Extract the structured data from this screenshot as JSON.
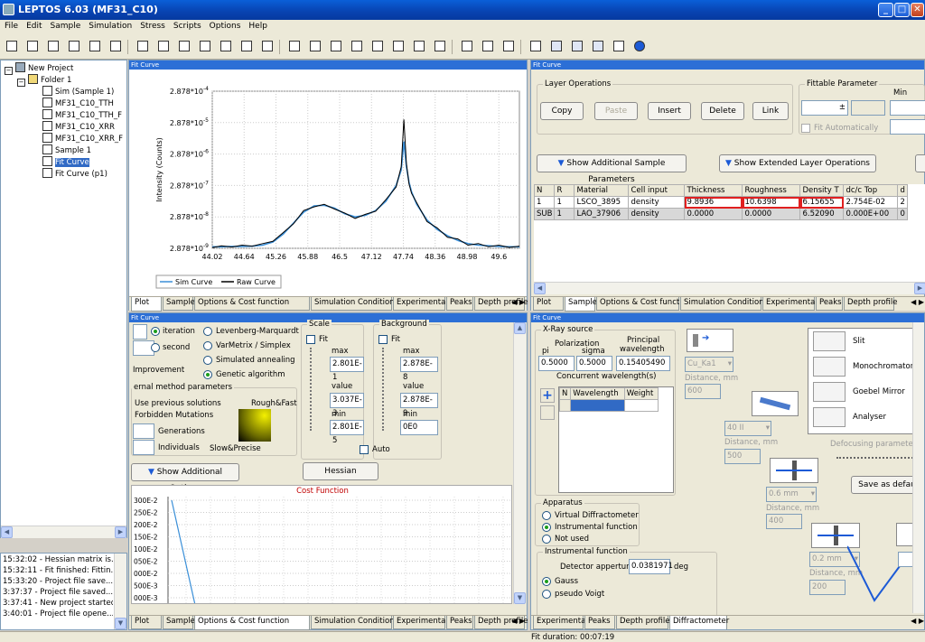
{
  "window": {
    "title": "LEPTOS 6.03 (MF31_C10)",
    "min": "_",
    "max": "□",
    "close": "✕"
  },
  "menu": [
    "File",
    "Edit",
    "Sample",
    "Simulation",
    "Stress",
    "Scripts",
    "Options",
    "Help"
  ],
  "tree": {
    "root": "New Project",
    "folder": "Folder 1",
    "items": [
      "Sim (Sample 1)",
      "MF31_C10_TTH",
      "MF31_C10_TTH_F",
      "MF31_C10_XRR",
      "MF31_C10_XRR_F",
      "Sample 1",
      "Fit Curve",
      "Fit Curve (p1)"
    ],
    "selected_index": 6
  },
  "log": [
    "15:32:02 - Hessian matrix is...",
    "15:32:11 - Fit finished: Fittin...",
    "15:33:20 - Project file save...",
    "3:37:37 - Project file saved...",
    "3:37:41 - New project started",
    "3:40:01 - Project file opene..."
  ],
  "panel_titles": {
    "top_left": "Fit Curve",
    "top_right": "Fit Curve",
    "bottom_left": "Fit Curve",
    "bottom_right": "Fit Curve"
  },
  "chart_data": {
    "type": "line",
    "title": "",
    "xlabel": "",
    "ylabel": "Intensity (Counts)",
    "log_y": true,
    "x_ticks": [
      "44.02",
      "44.64",
      "45.26",
      "45.88",
      "46.5",
      "47.12",
      "47.74",
      "48.36",
      "48.98",
      "49.6"
    ],
    "y_ticks": [
      "2.878*10^-4",
      "2.878*10^-5",
      "2.878*10^-6",
      "2.878*10^-7",
      "2.878*10^-8",
      "2.878*10^-9"
    ],
    "xlim": [
      44.02,
      50.0
    ],
    "ylim_exp": [
      -9,
      -4
    ],
    "legend": [
      "Sim Curve",
      "Raw Curve"
    ],
    "series": [
      {
        "name": "Sim Curve",
        "color": "#3a8fd8",
        "x": [
          44.02,
          44.2,
          44.4,
          44.6,
          44.8,
          45.0,
          45.2,
          45.4,
          45.6,
          45.8,
          46.0,
          46.2,
          46.4,
          46.6,
          46.8,
          47.0,
          47.2,
          47.4,
          47.6,
          47.7,
          47.75,
          47.8,
          47.85,
          47.9,
          48.0,
          48.2,
          48.4,
          48.6,
          48.8,
          49.0,
          49.2,
          49.4,
          49.6,
          49.8,
          50.0
        ],
        "log_y": [
          -8.95,
          -8.95,
          -8.94,
          -8.94,
          -8.93,
          -8.9,
          -8.8,
          -8.55,
          -8.2,
          -7.85,
          -7.65,
          -7.63,
          -7.72,
          -7.9,
          -8.0,
          -7.95,
          -7.8,
          -7.5,
          -7.0,
          -6.5,
          -5.6,
          -6.4,
          -6.9,
          -7.2,
          -7.6,
          -8.1,
          -8.4,
          -8.6,
          -8.75,
          -8.85,
          -8.9,
          -8.92,
          -8.94,
          -8.95,
          -8.95
        ]
      },
      {
        "name": "Raw Curve",
        "color": "#000000",
        "x": [
          44.02,
          44.2,
          44.4,
          44.6,
          44.8,
          45.0,
          45.2,
          45.4,
          45.6,
          45.8,
          46.0,
          46.2,
          46.4,
          46.6,
          46.8,
          47.0,
          47.2,
          47.4,
          47.6,
          47.7,
          47.75,
          47.8,
          47.85,
          47.9,
          48.0,
          48.2,
          48.4,
          48.6,
          48.8,
          49.0,
          49.2,
          49.4,
          49.6,
          49.8,
          50.0
        ],
        "log_y": [
          -8.98,
          -8.92,
          -8.96,
          -8.9,
          -8.93,
          -8.85,
          -8.78,
          -8.5,
          -8.22,
          -7.8,
          -7.68,
          -7.6,
          -7.75,
          -7.88,
          -8.05,
          -7.92,
          -7.82,
          -7.45,
          -7.05,
          -6.4,
          -4.9,
          -6.3,
          -6.95,
          -7.25,
          -7.55,
          -8.15,
          -8.35,
          -8.65,
          -8.7,
          -8.9,
          -8.85,
          -8.95,
          -8.9,
          -8.97,
          -8.93
        ]
      }
    ]
  },
  "tabs_left": [
    "Plot",
    "Sample",
    "Options & Cost function",
    "Simulation Conditions",
    "Experimental",
    "Peaks",
    "Depth profile"
  ],
  "tabs_left_active": 0,
  "tabs_right_top": [
    "Plot",
    "Sample",
    "Options & Cost function",
    "Simulation Conditions",
    "Experimental",
    "Peaks",
    "Depth profile"
  ],
  "tabs_right_top_active": 1,
  "tabs_left_bottom": [
    "Plot",
    "Sample",
    "Options & Cost function",
    "Simulation Conditions",
    "Experimental",
    "Peaks",
    "Depth profile"
  ],
  "tabs_left_bottom_active": 2,
  "tabs_right_bottom": [
    "Experimental",
    "Peaks",
    "Depth profile",
    "Diffractometer"
  ],
  "tabs_right_bottom_active": 3,
  "sample": {
    "layer_ops_label": "Layer Operations",
    "buttons": {
      "copy": "Copy",
      "paste": "Paste",
      "insert": "Insert",
      "delete": "Delete",
      "link": "Link"
    },
    "fittable_label": "Fittable Parameter",
    "min_label": "Min",
    "fit_auto": "Fit Automatically",
    "show_additional": "Show Additional Sample Parameters",
    "show_extended": "Show Extended Layer Operations",
    "columns": [
      "N",
      "R",
      "Material",
      "Cell input",
      "Thickness",
      "Roughness",
      "Density T",
      "dc/c Top",
      "d"
    ],
    "rows": [
      [
        "1",
        "1",
        "LSCO_3895",
        "density",
        "9.8936",
        "10.6398",
        "6.15655",
        "2.754E-02",
        "2"
      ],
      [
        "SUB",
        "1",
        "LAO_37906",
        "density",
        "0.0000",
        "0.0000",
        "6.52090",
        "0.000E+00",
        "0"
      ]
    ]
  },
  "options": {
    "iteration": "iteration",
    "second": "second",
    "improvement": "Improvement",
    "methods": [
      "Levenberg-Marquardt",
      "VarMetrix / Simplex",
      "Simulated annealing",
      "Genetic algorithm"
    ],
    "method_selected": 3,
    "gen_params": "ernal method parameters",
    "use_prev": "Use previous solutions",
    "rough_fast": "Rough&Fast",
    "forbidden": "Forbidden Mutations",
    "generations": "Generations",
    "individuals": "Individuals",
    "slow_precise": "Slow&Precise",
    "scale_label": "Scale",
    "background_label": "Background",
    "fit": "Fit",
    "max": "max",
    "value": "value",
    "min": "min",
    "scale_max": "2.801E-1",
    "scale_value": "3.037E-3",
    "scale_min": "2.801E-5",
    "bg_max": "2.878E-8",
    "bg_value": "2.878E-9",
    "bg_min": "0E0",
    "auto": "Auto",
    "show_additional": "Show Additional Options",
    "hessian": "Hessian",
    "cost_title": "Cost Function",
    "cost_ticks": [
      "300E-2",
      "250E-2",
      "200E-2",
      "150E-2",
      "100E-2",
      "050E-2",
      "000E-2",
      "500E-3",
      "000E-3"
    ]
  },
  "diffractometer": {
    "xray_source": "X-Ray source",
    "pi": "pi",
    "polarization": "Polarization",
    "sigma": "sigma",
    "principal": "Principal",
    "wavelength": "wavelength",
    "pi_val": "0.5000",
    "sigma_val": "0.5000",
    "wl_val": "0.15405490",
    "concurrent": "Concurrent wavelength(s)",
    "table_cols": [
      "N",
      "Wavelength",
      "Weight"
    ],
    "apparatus": "Apparatus",
    "app_opts": [
      "Virtual Diffractometer",
      "Instrumental function",
      "Not used"
    ],
    "app_selected": 1,
    "instr_fn": "Instrumental function",
    "detector": "Detector apperture",
    "detector_val": "0.0381971",
    "deg": "deg",
    "gauss": "Gauss",
    "voigt": "pseudo Voigt",
    "source_sel": "Cu_Ka1",
    "distance": "Distance, mm",
    "dist1": "600",
    "crystal_sel": "40 II",
    "dist2": "500",
    "slit1": "0.6 mm",
    "dist3": "400",
    "slit2": "0.2 mm",
    "dist4": "200",
    "legend": [
      "Slit",
      "Monochromator",
      "Goebel Mirror",
      "Analyser"
    ],
    "defocusing": "Defocusing parameter (",
    "save_default": "Save as default"
  },
  "status": {
    "fit_duration": "Fit duration: 00:07:19"
  }
}
